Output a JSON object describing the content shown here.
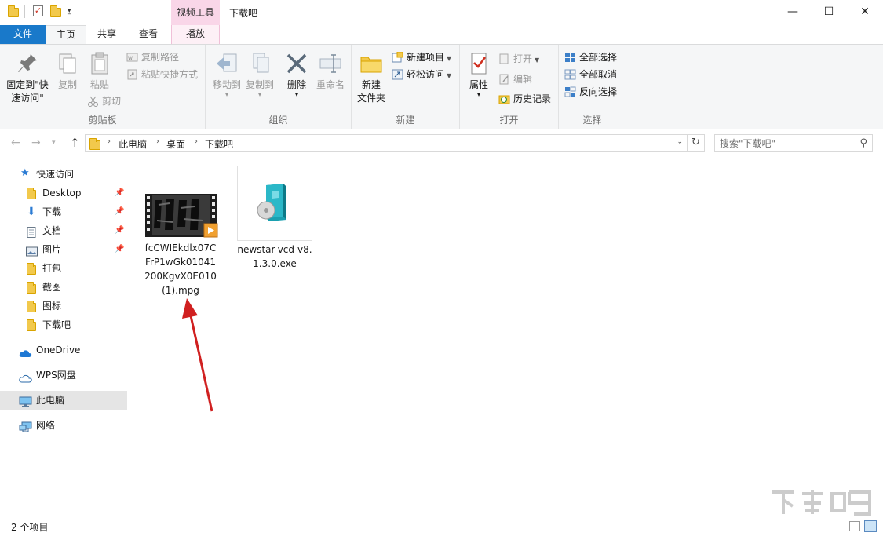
{
  "window": {
    "title": "下载吧",
    "context_tab_group": "视频工具",
    "minimize": "—",
    "maximize": "☐",
    "close": "✕"
  },
  "ribbon_tabs": [
    {
      "label": "文件"
    },
    {
      "label": "主页"
    },
    {
      "label": "共享"
    },
    {
      "label": "查看"
    },
    {
      "label": "播放"
    }
  ],
  "ribbon": {
    "clipboard": {
      "group_label": "剪贴板",
      "pin_quick_access": "固定到\"快速访问\"",
      "copy": "复制",
      "paste": "粘贴",
      "copy_path": "复制路径",
      "paste_shortcut": "粘贴快捷方式",
      "cut": "剪切"
    },
    "organize": {
      "group_label": "组织",
      "move_to": "移动到",
      "copy_to": "复制到",
      "delete": "删除",
      "rename": "重命名"
    },
    "new": {
      "group_label": "新建",
      "new_folder": "新建\n文件夹",
      "new_item": "新建项目",
      "easy_access": "轻松访问"
    },
    "open": {
      "group_label": "打开",
      "properties": "属性",
      "open": "打开",
      "edit": "编辑",
      "history": "历史记录"
    },
    "select": {
      "group_label": "选择",
      "select_all": "全部选择",
      "select_none": "全部取消",
      "invert": "反向选择"
    }
  },
  "address": {
    "breadcrumbs": [
      "此电脑",
      "桌面",
      "下载吧"
    ],
    "search_placeholder": "搜索\"下载吧\""
  },
  "nav_pane": {
    "quick_access": "快速访问",
    "items": [
      {
        "label": "Desktop",
        "pinned": true
      },
      {
        "label": "下载",
        "pinned": true
      },
      {
        "label": "文档",
        "pinned": true
      },
      {
        "label": "图片",
        "pinned": true
      },
      {
        "label": "打包",
        "pinned": false
      },
      {
        "label": "截图",
        "pinned": false
      },
      {
        "label": "图标",
        "pinned": false
      },
      {
        "label": "下载吧",
        "pinned": false
      }
    ],
    "onedrive": "OneDrive",
    "wps": "WPS网盘",
    "this_pc": "此电脑",
    "network": "网络"
  },
  "files": [
    {
      "name": "fcCWIEkdlx07CFrP1wGk01041200KgvX0E010(1).mpg",
      "type": "video"
    },
    {
      "name": "newstar-vcd-v8.1.3.0.exe",
      "type": "exe"
    }
  ],
  "status": {
    "item_count": "2 个项目"
  },
  "colors": {
    "file_tab": "#1979ca",
    "context_tab": "#f9d6e8",
    "selection": "#e5e5e5",
    "arrow": "#d02020"
  }
}
